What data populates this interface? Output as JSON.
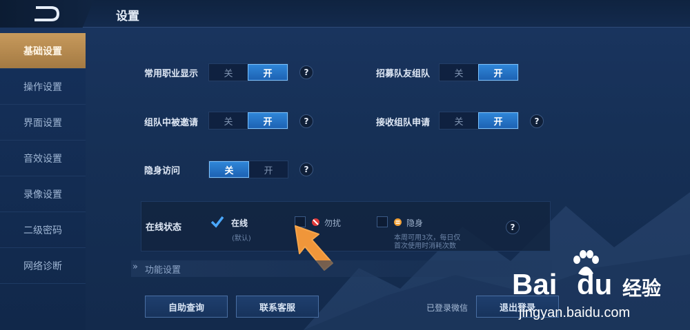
{
  "header": {
    "title": "设置"
  },
  "sidebar": {
    "items": [
      {
        "label": "基础设置"
      },
      {
        "label": "操作设置"
      },
      {
        "label": "界面设置"
      },
      {
        "label": "音效设置"
      },
      {
        "label": "录像设置"
      },
      {
        "label": "二级密码"
      },
      {
        "label": "网络诊断"
      }
    ]
  },
  "settings": {
    "job_display": {
      "label": "常用职业显示",
      "off": "关",
      "on": "开",
      "value": "开"
    },
    "recruit_team": {
      "label": "招募队友组队",
      "off": "关",
      "on": "开",
      "value": "开"
    },
    "invited_in_team": {
      "label": "组队中被邀请",
      "off": "关",
      "on": "开",
      "value": "开"
    },
    "receive_team_request": {
      "label": "接收组队申请",
      "off": "关",
      "on": "开",
      "value": "开"
    },
    "stealth_visit": {
      "label": "隐身访问",
      "off": "关",
      "on": "开",
      "value": "关"
    },
    "help": "?"
  },
  "online_status": {
    "label": "在线状态",
    "options": [
      {
        "label": "在线",
        "sub": "(默认)",
        "checked": true
      },
      {
        "label": "勿扰",
        "checked": false
      },
      {
        "label": "隐身",
        "note_line1": "本周可用3次，每日仅",
        "note_line2": "首次使用时消耗次数",
        "checked": false
      }
    ]
  },
  "section": {
    "label": "功能设置"
  },
  "bottom": {
    "self_query": "自助查询",
    "contact_service": "联系客服",
    "logged_in": "已登录微信",
    "logout": "退出登录"
  },
  "watermark": {
    "brand": "Bai",
    "brand2": "du",
    "cn": "经验",
    "url": "jingyan.baidu.com"
  },
  "colors": {
    "accent": "#2f86d8",
    "active_tab": "#c79a5c",
    "pointer": "#f0963a"
  }
}
